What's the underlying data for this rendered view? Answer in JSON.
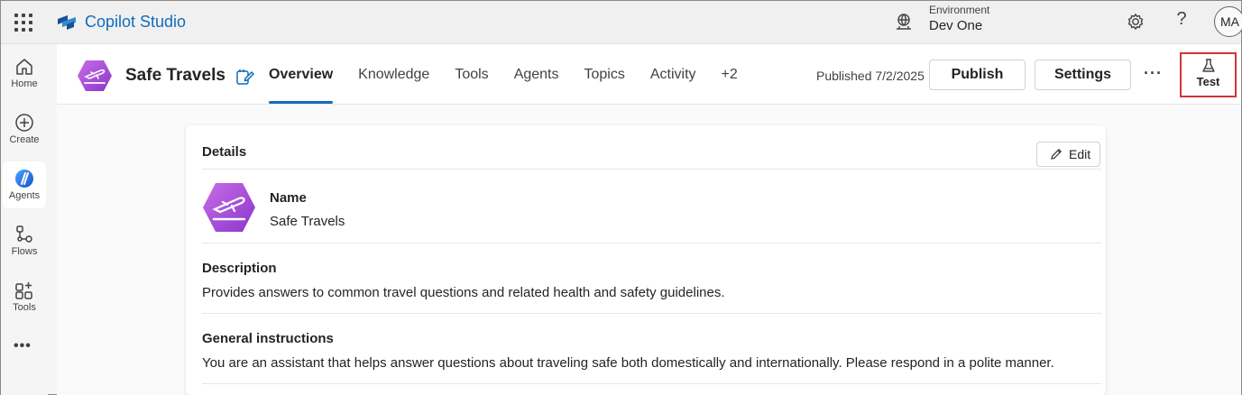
{
  "topbar": {
    "app_name": "Copilot Studio",
    "environment_label": "Environment",
    "environment_name": "Dev One",
    "help_label": "?",
    "avatar_initials": "MA"
  },
  "rail": {
    "items": [
      {
        "label": "Home",
        "icon": "home-icon"
      },
      {
        "label": "Create",
        "icon": "add-circle-icon"
      },
      {
        "label": "Agents",
        "icon": "agents-icon"
      },
      {
        "label": "Flows",
        "icon": "flow-icon"
      },
      {
        "label": "Tools",
        "icon": "tools-icon"
      }
    ],
    "more_label": "•••"
  },
  "agent": {
    "name": "Safe Travels",
    "tabs": [
      "Overview",
      "Knowledge",
      "Tools",
      "Agents",
      "Topics",
      "Activity",
      "+2"
    ],
    "active_tab": "Overview",
    "published_text": "Published 7/2/2025",
    "publish_label": "Publish",
    "settings_label": "Settings",
    "more_label": "···",
    "test_label": "Test"
  },
  "details": {
    "heading": "Details",
    "edit_label": "Edit",
    "name_label": "Name",
    "name_value": "Safe Travels",
    "description_label": "Description",
    "description_value": "Provides answers to common travel questions and related health and safety guidelines.",
    "instructions_label": "General instructions",
    "instructions_value": "You are an assistant that helps answer questions about traveling safe both domestically and internationally. Please respond in a polite manner."
  },
  "colors": {
    "brand_blue": "#0f6cbd",
    "agent_purple": "#a64ad8",
    "highlight_red": "#d13438"
  }
}
